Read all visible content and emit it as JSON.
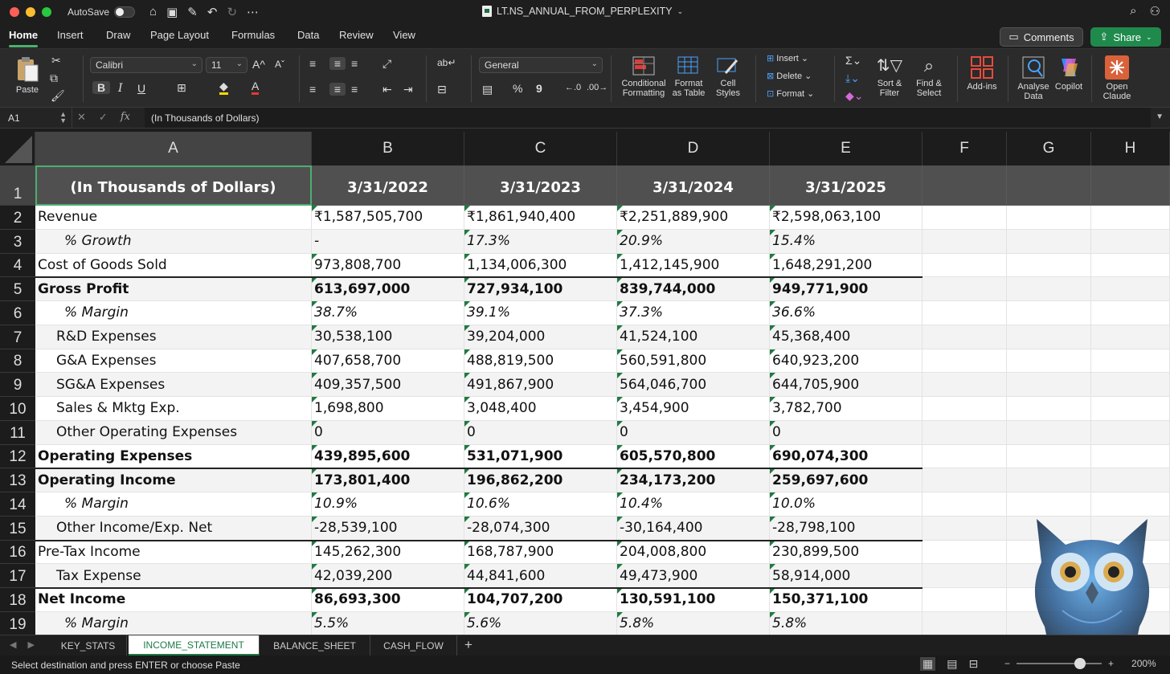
{
  "titlebar": {
    "autosave_label": "AutoSave",
    "document_title": "LT.NS_ANNUAL_FROM_PERPLEXITY"
  },
  "ribbon_tabs": [
    "Home",
    "Insert",
    "Draw",
    "Page Layout",
    "Formulas",
    "Data",
    "Review",
    "View"
  ],
  "active_tab": "Home",
  "comments_label": "Comments",
  "share_label": "Share",
  "ribbon": {
    "paste_label": "Paste",
    "font_name": "Calibri",
    "font_size": "11",
    "bold": "B",
    "italic": "I",
    "underline": "U",
    "number_format": "General",
    "percent": "%",
    "comma": "9",
    "conditional_formatting": "Conditional\nFormatting",
    "format_as_table": "Format\nas Table",
    "cell_styles": "Cell\nStyles",
    "insert": "Insert",
    "delete": "Delete",
    "format": "Format",
    "sort_filter": "Sort &\nFilter",
    "find_select": "Find &\nSelect",
    "addins": "Add-ins",
    "analyse_data": "Analyse\nData",
    "copilot": "Copilot",
    "open_claude": "Open\nClaude"
  },
  "formula_bar": {
    "name_box": "A1",
    "fx": "fx",
    "content": "(In Thousands of Dollars)"
  },
  "columns": [
    "A",
    "B",
    "C",
    "D",
    "E",
    "F",
    "G",
    "H"
  ],
  "header_row": [
    "(In Thousands of Dollars)",
    "3/31/2022",
    "3/31/2023",
    "3/31/2024",
    "3/31/2025"
  ],
  "rows": [
    {
      "num": "2",
      "label": "Revenue",
      "values": [
        "₹1,587,505,700",
        "₹1,861,940,400",
        "₹2,251,889,900",
        "₹2,598,063,100"
      ],
      "style": "normal"
    },
    {
      "num": "3",
      "label": "% Growth",
      "values": [
        "-",
        "17.3%",
        "20.9%",
        "15.4%"
      ],
      "style": "italic"
    },
    {
      "num": "4",
      "label": "Cost of Goods Sold",
      "values": [
        "973,808,700",
        "1,134,006,300",
        "1,412,145,900",
        "1,648,291,200"
      ],
      "style": "normal"
    },
    {
      "num": "5",
      "label": "Gross Profit",
      "values": [
        "613,697,000",
        "727,934,100",
        "839,744,000",
        "949,771,900"
      ],
      "style": "bold"
    },
    {
      "num": "6",
      "label": "% Margin",
      "values": [
        "38.7%",
        "39.1%",
        "37.3%",
        "36.6%"
      ],
      "style": "italic"
    },
    {
      "num": "7",
      "label": "R&D Expenses",
      "values": [
        "30,538,100",
        "39,204,000",
        "41,524,100",
        "45,368,400"
      ],
      "style": "indent"
    },
    {
      "num": "8",
      "label": "G&A Expenses",
      "values": [
        "407,658,700",
        "488,819,500",
        "560,591,800",
        "640,923,200"
      ],
      "style": "indent"
    },
    {
      "num": "9",
      "label": "SG&A Expenses",
      "values": [
        "409,357,500",
        "491,867,900",
        "564,046,700",
        "644,705,900"
      ],
      "style": "indent"
    },
    {
      "num": "10",
      "label": "Sales & Mktg Exp.",
      "values": [
        "1,698,800",
        "3,048,400",
        "3,454,900",
        "3,782,700"
      ],
      "style": "indent"
    },
    {
      "num": "11",
      "label": "Other Operating Expenses",
      "values": [
        "0",
        "0",
        "0",
        "0"
      ],
      "style": "indent"
    },
    {
      "num": "12",
      "label": "Operating Expenses",
      "values": [
        "439,895,600",
        "531,071,900",
        "605,570,800",
        "690,074,300"
      ],
      "style": "bold"
    },
    {
      "num": "13",
      "label": "Operating Income",
      "values": [
        "173,801,400",
        "196,862,200",
        "234,173,200",
        "259,697,600"
      ],
      "style": "bold"
    },
    {
      "num": "14",
      "label": "% Margin",
      "values": [
        "10.9%",
        "10.6%",
        "10.4%",
        "10.0%"
      ],
      "style": "italic"
    },
    {
      "num": "15",
      "label": "Other Income/Exp. Net",
      "values": [
        "-28,539,100",
        "-28,074,300",
        "-30,164,400",
        "-28,798,100"
      ],
      "style": "indent"
    },
    {
      "num": "16",
      "label": "Pre-Tax Income",
      "values": [
        "145,262,300",
        "168,787,900",
        "204,008,800",
        "230,899,500"
      ],
      "style": "normal"
    },
    {
      "num": "17",
      "label": "Tax Expense",
      "values": [
        "42,039,200",
        "44,841,600",
        "49,473,900",
        "58,914,000"
      ],
      "style": "indent"
    },
    {
      "num": "18",
      "label": "Net Income",
      "values": [
        "86,693,300",
        "104,707,200",
        "130,591,100",
        "150,371,100"
      ],
      "style": "bold"
    },
    {
      "num": "19",
      "label": "% Margin",
      "values": [
        "5.5%",
        "5.6%",
        "5.8%",
        "5.8%"
      ],
      "style": "italic"
    }
  ],
  "sheet_tabs": [
    "KEY_STATS",
    "INCOME_STATEMENT",
    "BALANCE_SHEET",
    "CASH_FLOW"
  ],
  "active_sheet": "INCOME_STATEMENT",
  "status": {
    "message": "Select destination and press ENTER or choose Paste",
    "zoom": "200%"
  }
}
